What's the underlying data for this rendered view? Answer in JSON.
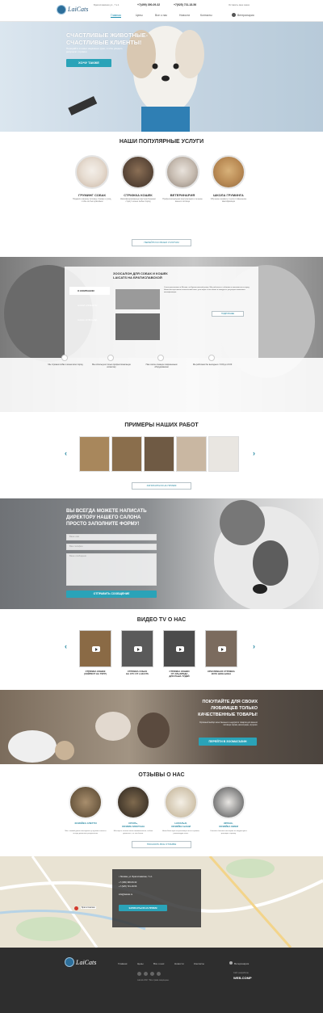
{
  "header": {
    "logo_text": "LaiCats",
    "address": "Братиславская ул., 7 к.1",
    "phone1": "+7(499) 390-09-32",
    "phone2": "+7(925) 731-18-56",
    "order_call": "Оставить ваш заказ",
    "nav": [
      "Главная",
      "Цены",
      "Все о нас",
      "Новости",
      "Контакты"
    ],
    "vet": "Ветеринария"
  },
  "hero": {
    "title_line1": "СЧАСТЛИВЫЕ ЖИВОТНЫЕ-",
    "title_line2": "СЧАСТЛИВЫЕ КЛИЕНТЫ!",
    "subtitle": "Передайте в наши надёжные руки, чтобы увидеть результат стрижки",
    "button": "ХОЧУ ТАКЖЕ"
  },
  "services": {
    "title": "НАШИ ПОПУЛЯРНЫЕ УСЛУГИ",
    "items": [
      {
        "name": "ГРУМИНГ СОБАК",
        "desc": "Подарите вашему питомцу стрижку и уход, чтобы он был красивым"
      },
      {
        "name": "СТРИЖКА КОШЕК",
        "desc": "Квалифицированные мастера бережно стригут кошек любых пород"
      },
      {
        "name": "ВЕТЕРИНАРИЯ",
        "desc": "Профессиональная консультация и лечение вашего питомца"
      },
      {
        "name": "ШКОЛА ГРУМИНГА",
        "desc": "Обучение грумингу с нуля и повышение квалификации"
      }
    ],
    "all_button": "ПЕРЕЙТИ КО ВСЕМ УСЛУГАМ"
  },
  "salon": {
    "title_line1": "ЗООСАЛОН ДЛЯ СОБАК И КОШЕК",
    "title_line2": "LAICATS НА БРАТИСЛАВСКОЙ",
    "tabs": [
      "О КОМПАНИИ",
      "НАШИ КЛИЕНТЫ",
      "НАША КОМАНДА"
    ],
    "text": "Салон расположен в Москве, на Братиславской улице. Мы работаем с собаками и кошками всех пород. Наши мастера имеют многолетний опыт, участвуют в выставках и конкурсах, регулярно повышают квалификацию.",
    "more": "ПОДРОБНЕЕ",
    "stats": [
      "Мы стрижем собак и кошек всех пород",
      "Мы используем только профессиональную косметику",
      "Наш салон оснащён современным оборудованием",
      "Мы работаем без выходных с 9:00 до 21:00"
    ]
  },
  "works": {
    "title": "ПРИМЕРЫ НАШИХ РАБОТ",
    "button": "ЗАПИСАТЬСЯ НА ПРИЕМ"
  },
  "contact": {
    "title_line1": "ВЫ ВСЕГДА МОЖЕТЕ НАПИСАТЬ",
    "title_line2": "ДИРЕКТОРУ НАШЕГО САЛОНА",
    "title_line3": "ПРОСТО ЗАПОЛНИТЕ ФОРМУ!",
    "name_placeholder": "Ваше имя",
    "phone_placeholder": "Ваш телефон",
    "message_placeholder": "Ваше сообщение",
    "button": "ОТПРАВИТЬ СООБЩЕНИЕ"
  },
  "videos": {
    "title": "ВИДЕО TV О НАС",
    "items": [
      {
        "cap1": "СТРИЖКА КОШЕК",
        "cap2": "(ХЭЙРКОТ НА ТИГР)"
      },
      {
        "cap1": "СТРИЖКА СОБАК",
        "cap2": "НА СТС ОТ LAICATS"
      },
      {
        "cap1": "СТРИЖКА КОШКИ",
        "cap2": "ОТ АЛЬФРЕДА",
        "cap3": "ДЛЯ РАША ТУДЕЙ"
      },
      {
        "cap1": "КРЕАТИВНАЯ СТРИЖКА",
        "cap2": "КОТА ШОН-БОНА"
      }
    ]
  },
  "shop": {
    "title_line1": "ПОКУПАЙТЕ ДЛЯ СВОИХ",
    "title_line2": "ЛЮБИМЦЕВ ТОЛЬКО",
    "title_line3": "КАЧЕСТВЕННЫЕ ТОВАРЫ!",
    "text": "Огромный выбор качественных и недорогих товаров для вашего питомца: корма, аксессуары, игрушки.",
    "button": "ПЕРЕЙТИ В ЗООМАГАЗИН"
  },
  "reviews": {
    "title": "ОТЗЫВЫ О НАС",
    "items": [
      {
        "name1": "ХОЗЯЙКА СЛЕТТИ",
        "name2": "",
        "text": "Мы с мамой давно пользуемся услугами салона и всегда довольны результатом."
      },
      {
        "name1": "ИГОРЬ,",
        "name2": "ХОЗЯИН МОКТАНА",
        "text": "Мастера в салоне очень внимательные, собака довольна, а я тем более."
      },
      {
        "name1": "НАТАЛЬЯ,",
        "name2": "ХОЗЯЙКА БОНИ",
        "text": "Наша Бони просто красавица после стрижки, рекомендую всем."
      },
      {
        "name1": "ИРИНА,",
        "name2": "ХОЗЯЙКА МИКИ",
        "text": "Спасибо большое мастерам за аккуратную и красивую стрижку."
      }
    ],
    "button": "ПОКАЗАТЬ ВСЕ ОТЗЫВЫ"
  },
  "map": {
    "address": "г. Москва, ул. Братиславская, 7 к.1",
    "phone1": "+7 (499) 390-09-32",
    "phone2": "+7 (925) 731-18-56",
    "email": "info@laicats.ru",
    "button": "ЗАПИСАТЬСЯ НА ПРИЕМ",
    "marker": "Братиславская"
  },
  "footer": {
    "logo_text": "LaiCats",
    "nav": [
      "Главная",
      "Цены",
      "Все о нас",
      "Новости",
      "Контакты"
    ],
    "vet": "Ветеринария",
    "copyright": "Laicats 2017. Все права защищены.",
    "dev_label": "Сайт разработан",
    "dev": "WEB-COMP"
  }
}
